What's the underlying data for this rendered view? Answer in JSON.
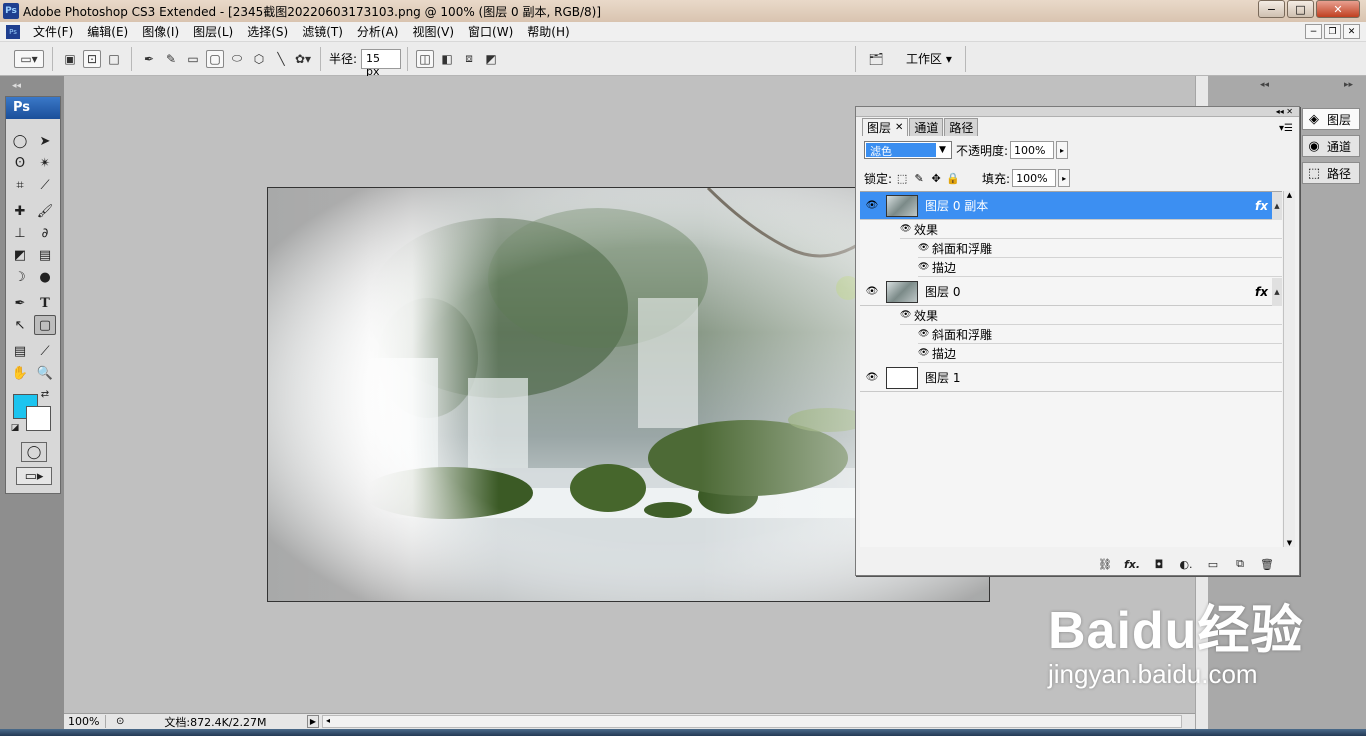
{
  "window": {
    "title": "Adobe Photoshop CS3 Extended - [2345截图20220603173103.png @ 100% (图层 0 副本, RGB/8)]",
    "app_badge": "Ps",
    "controls": {
      "minimize": "−",
      "maximize": "□",
      "close": "✕"
    }
  },
  "menubar": {
    "items": [
      "文件(F)",
      "编辑(E)",
      "图像(I)",
      "图层(L)",
      "选择(S)",
      "滤镜(T)",
      "分析(A)",
      "视图(V)",
      "窗口(W)",
      "帮助(H)"
    ]
  },
  "options": {
    "radius_label": "半径:",
    "radius_value": "15 px",
    "workspace_label": "工作区 ▾"
  },
  "toolbox": {
    "badge": "Ps",
    "foreground_color": "#1cc4ef",
    "background_color": "#ffffff"
  },
  "status": {
    "zoom": "100%",
    "doc_info": "文档:872.4K/2.27M"
  },
  "layers_panel": {
    "tabs": [
      {
        "label": "图层",
        "active": true
      },
      {
        "label": "通道",
        "active": false
      },
      {
        "label": "路径",
        "active": false
      }
    ],
    "blend_mode": "滤色",
    "opacity_label": "不透明度:",
    "opacity_value": "100%",
    "lock_label": "锁定:",
    "fill_label": "填充:",
    "fill_value": "100%",
    "layers": [
      {
        "name": "图层 0 副本",
        "selected": true,
        "fx": "fx",
        "effects_label": "效果",
        "effects": [
          "斜面和浮雕",
          "描边"
        ]
      },
      {
        "name": "图层 0",
        "selected": false,
        "fx": "fx",
        "effects_label": "效果",
        "effects": [
          "斜面和浮雕",
          "描边"
        ]
      },
      {
        "name": "图层 1",
        "selected": false
      }
    ]
  },
  "dock": {
    "items": [
      "图层",
      "通道",
      "路径"
    ]
  },
  "watermark": {
    "brand": "Baidu经验",
    "url": "jingyan.baidu.com"
  }
}
